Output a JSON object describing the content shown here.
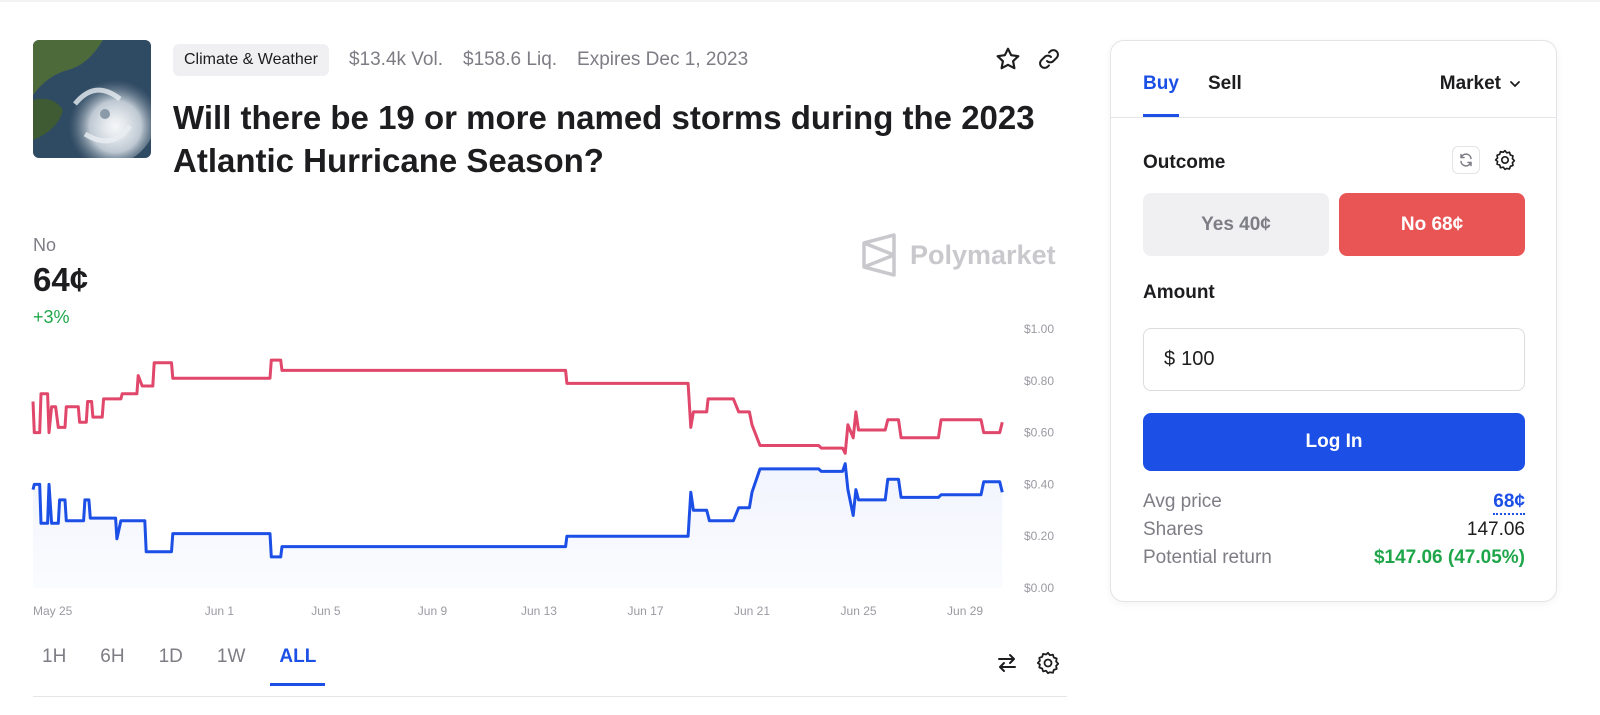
{
  "market": {
    "category": "Climate & Weather",
    "volume": "$13.4k Vol.",
    "liquidity": "$158.6 Liq.",
    "expires": "Expires Dec 1, 2023",
    "title": "Will there be 19 or more named storms during the 2023 Atlantic Hurricane Season?"
  },
  "icons": {
    "star": "star-icon",
    "link": "link-icon",
    "swap": "swap-icon",
    "settings": "gear-icon",
    "refresh": "refresh-icon",
    "chevron": "chevron-down-icon"
  },
  "price_block": {
    "outcome": "No",
    "price": "64¢",
    "change": "+3%"
  },
  "brand": {
    "name": "Polymarket"
  },
  "time_tabs": [
    "1H",
    "6H",
    "1D",
    "1W",
    "ALL"
  ],
  "active_time_tab": "ALL",
  "trade": {
    "buy": "Buy",
    "sell": "Sell",
    "order_type": "Market",
    "outcome_label": "Outcome",
    "yes_label": "Yes 40¢",
    "no_label": "No 68¢",
    "amount_label": "Amount",
    "currency": "$",
    "amount_value": "100",
    "login": "Log In",
    "avg_price_label": "Avg price",
    "avg_price": "68¢",
    "shares_label": "Shares",
    "shares": "147.06",
    "return_label": "Potential return",
    "return_value": "$147.06 (47.05%)"
  },
  "colors": {
    "accent": "#1c4fe6",
    "no_series": "#e0476a",
    "yes_series": "#1c4fe6",
    "no_button": "#e95555",
    "positive": "#1fa64a"
  },
  "chart_data": {
    "type": "line",
    "x_ticks": [
      "May 25",
      "Jun 1",
      "Jun 5",
      "Jun 9",
      "Jun 13",
      "Jun 17",
      "Jun 21",
      "Jun 25",
      "Jun 29"
    ],
    "y_ticks": [
      "$1.00",
      "$0.80",
      "$0.60",
      "$0.40",
      "$0.20",
      "$0.00"
    ],
    "ylim": [
      0,
      1
    ],
    "x_range_days": [
      0,
      36.5
    ],
    "series": [
      {
        "name": "No",
        "color": "#e0476a",
        "points": [
          [
            0,
            0.72
          ],
          [
            0.05,
            0.6
          ],
          [
            0.25,
            0.6
          ],
          [
            0.3,
            0.75
          ],
          [
            0.55,
            0.75
          ],
          [
            0.6,
            0.6
          ],
          [
            0.7,
            0.7
          ],
          [
            0.8,
            0.7
          ],
          [
            0.85,
            0.7
          ],
          [
            0.95,
            0.62
          ],
          [
            1.2,
            0.62
          ],
          [
            1.25,
            0.7
          ],
          [
            1.7,
            0.7
          ],
          [
            1.75,
            0.64
          ],
          [
            2.0,
            0.64
          ],
          [
            2.05,
            0.72
          ],
          [
            2.2,
            0.72
          ],
          [
            2.25,
            0.66
          ],
          [
            2.6,
            0.66
          ],
          [
            2.65,
            0.73
          ],
          [
            3.3,
            0.73
          ],
          [
            3.35,
            0.75
          ],
          [
            3.9,
            0.75
          ],
          [
            3.95,
            0.82
          ],
          [
            4.1,
            0.78
          ],
          [
            4.5,
            0.78
          ],
          [
            4.55,
            0.87
          ],
          [
            5.2,
            0.87
          ],
          [
            5.25,
            0.81
          ],
          [
            8.9,
            0.81
          ],
          [
            8.95,
            0.88
          ],
          [
            9.3,
            0.88
          ],
          [
            9.35,
            0.84
          ],
          [
            20.0,
            0.84
          ],
          [
            20.05,
            0.79
          ],
          [
            24.6,
            0.79
          ],
          [
            24.7,
            0.62
          ],
          [
            24.8,
            0.68
          ],
          [
            25.3,
            0.68
          ],
          [
            25.35,
            0.73
          ],
          [
            26.3,
            0.73
          ],
          [
            26.5,
            0.68
          ],
          [
            26.9,
            0.68
          ],
          [
            27.0,
            0.63
          ],
          [
            27.3,
            0.55
          ],
          [
            29.5,
            0.55
          ],
          [
            29.6,
            0.54
          ],
          [
            30.4,
            0.54
          ],
          [
            30.5,
            0.52
          ],
          [
            30.6,
            0.63
          ],
          [
            30.8,
            0.58
          ],
          [
            30.9,
            0.68
          ],
          [
            31.0,
            0.61
          ],
          [
            32.0,
            0.61
          ],
          [
            32.1,
            0.65
          ],
          [
            32.5,
            0.65
          ],
          [
            32.6,
            0.58
          ],
          [
            34.0,
            0.58
          ],
          [
            34.1,
            0.65
          ],
          [
            35.6,
            0.65
          ],
          [
            35.7,
            0.6
          ],
          [
            36.3,
            0.6
          ],
          [
            36.4,
            0.64
          ]
        ]
      },
      {
        "name": "Yes",
        "color": "#1c4fe6",
        "points": [
          [
            0,
            0.38
          ],
          [
            0.05,
            0.4
          ],
          [
            0.25,
            0.4
          ],
          [
            0.3,
            0.25
          ],
          [
            0.55,
            0.25
          ],
          [
            0.6,
            0.4
          ],
          [
            0.7,
            0.25
          ],
          [
            0.95,
            0.25
          ],
          [
            1.0,
            0.34
          ],
          [
            1.2,
            0.34
          ],
          [
            1.25,
            0.26
          ],
          [
            1.9,
            0.26
          ],
          [
            1.95,
            0.34
          ],
          [
            2.1,
            0.34
          ],
          [
            2.15,
            0.27
          ],
          [
            3.1,
            0.27
          ],
          [
            3.15,
            0.19
          ],
          [
            3.3,
            0.26
          ],
          [
            4.2,
            0.26
          ],
          [
            4.25,
            0.14
          ],
          [
            5.2,
            0.14
          ],
          [
            5.25,
            0.21
          ],
          [
            8.9,
            0.21
          ],
          [
            8.95,
            0.12
          ],
          [
            9.3,
            0.12
          ],
          [
            9.35,
            0.16
          ],
          [
            20.0,
            0.16
          ],
          [
            20.05,
            0.2
          ],
          [
            24.6,
            0.2
          ],
          [
            24.7,
            0.37
          ],
          [
            24.8,
            0.3
          ],
          [
            25.3,
            0.3
          ],
          [
            25.4,
            0.26
          ],
          [
            26.3,
            0.26
          ],
          [
            26.5,
            0.31
          ],
          [
            26.9,
            0.31
          ],
          [
            27.0,
            0.37
          ],
          [
            27.3,
            0.46
          ],
          [
            29.5,
            0.46
          ],
          [
            29.6,
            0.45
          ],
          [
            30.4,
            0.45
          ],
          [
            30.5,
            0.48
          ],
          [
            30.6,
            0.38
          ],
          [
            30.8,
            0.28
          ],
          [
            30.9,
            0.38
          ],
          [
            31.0,
            0.34
          ],
          [
            32.0,
            0.34
          ],
          [
            32.1,
            0.42
          ],
          [
            32.5,
            0.42
          ],
          [
            32.6,
            0.35
          ],
          [
            34.0,
            0.35
          ],
          [
            34.1,
            0.36
          ],
          [
            35.6,
            0.36
          ],
          [
            35.7,
            0.41
          ],
          [
            36.3,
            0.41
          ],
          [
            36.4,
            0.37
          ]
        ]
      }
    ]
  }
}
